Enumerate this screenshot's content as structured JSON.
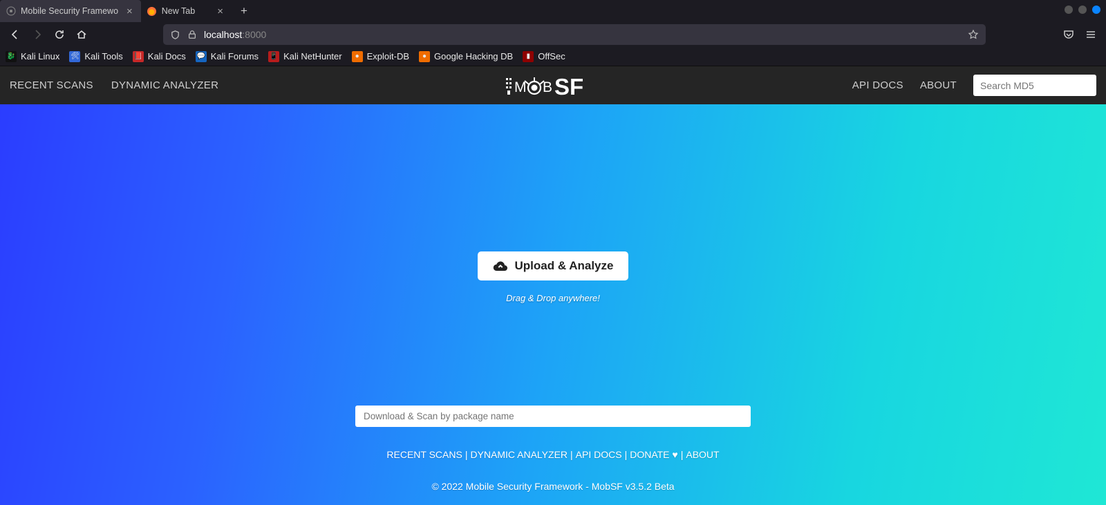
{
  "browser": {
    "tabs": [
      {
        "title": "Mobile Security Framewo"
      },
      {
        "title": "New Tab"
      }
    ],
    "url_host": "localhost",
    "url_port": ":8000"
  },
  "bookmarks": [
    {
      "label": "Kali Linux"
    },
    {
      "label": "Kali Tools"
    },
    {
      "label": "Kali Docs"
    },
    {
      "label": "Kali Forums"
    },
    {
      "label": "Kali NetHunter"
    },
    {
      "label": "Exploit-DB"
    },
    {
      "label": "Google Hacking DB"
    },
    {
      "label": "OffSec"
    }
  ],
  "app": {
    "nav_left": {
      "recent": "RECENT SCANS",
      "dynamic": "DYNAMIC ANALYZER"
    },
    "nav_right": {
      "api": "API DOCS",
      "about": "ABOUT"
    },
    "search_placeholder": "Search MD5"
  },
  "hero": {
    "upload_label": "Upload & Analyze",
    "dragdrop": "Drag & Drop anywhere!",
    "package_placeholder": "Download & Scan by package name"
  },
  "footer": {
    "links": {
      "recent": "RECENT SCANS",
      "dynamic": "DYNAMIC ANALYZER",
      "api": "API DOCS",
      "donate": "DONATE ♥",
      "about": "ABOUT"
    },
    "copyright": "© 2022 Mobile Security Framework - MobSF v3.5.2 Beta"
  }
}
